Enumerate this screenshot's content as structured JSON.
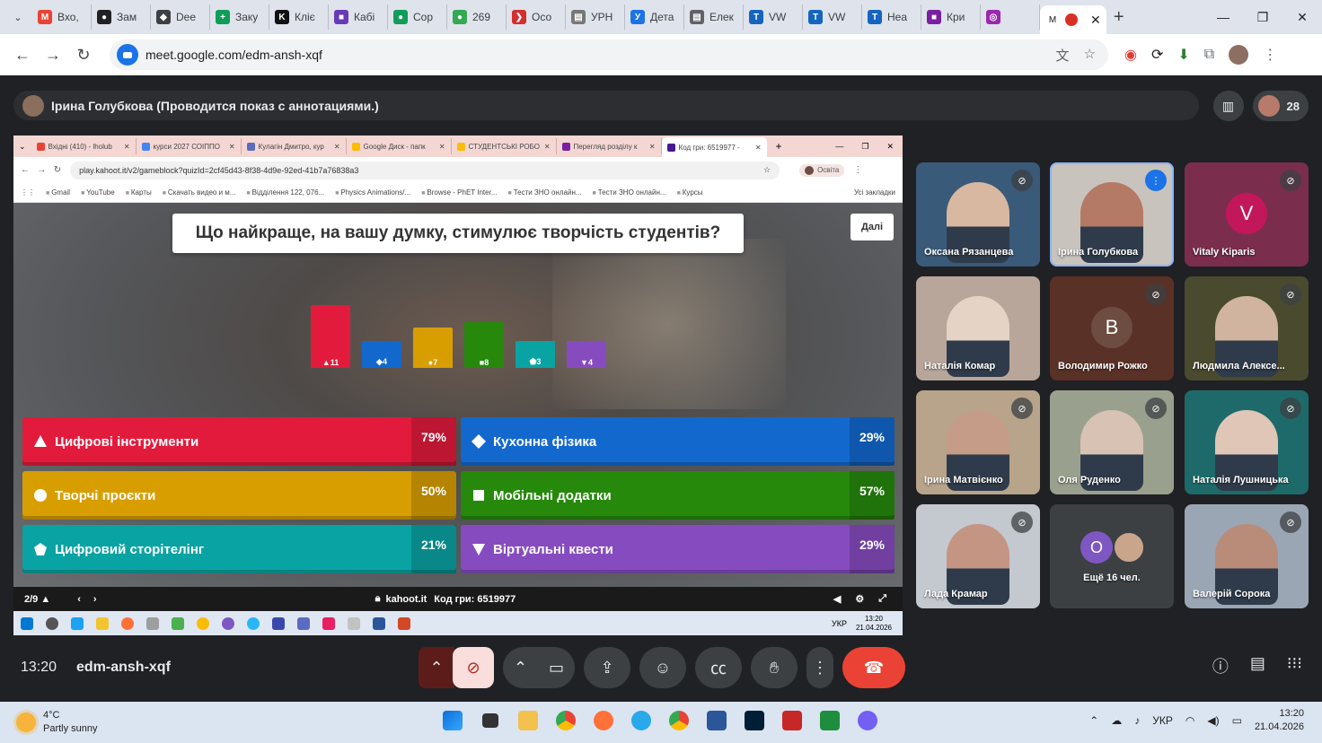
{
  "outer_tabs": [
    {
      "label": "Вхо,",
      "color": "#ea4335",
      "glyph": "M"
    },
    {
      "label": "Зам",
      "color": "#202124",
      "glyph": "●"
    },
    {
      "label": "Dee",
      "color": "#3c4043",
      "glyph": "◆"
    },
    {
      "label": "Заку",
      "color": "#0f9d58",
      "glyph": "+"
    },
    {
      "label": "Кліє",
      "color": "#111",
      "glyph": "K"
    },
    {
      "label": "Кабі",
      "color": "#673ab7",
      "glyph": "■"
    },
    {
      "label": "Сор",
      "color": "#0f9d58",
      "glyph": "●"
    },
    {
      "label": "269",
      "color": "#34a853",
      "glyph": "●"
    },
    {
      "label": "Осо",
      "color": "#d32f2f",
      "glyph": "❯"
    },
    {
      "label": "УРН",
      "color": "#777",
      "glyph": "▤"
    },
    {
      "label": "Дета",
      "color": "#1a73e8",
      "glyph": "У"
    },
    {
      "label": "Елек",
      "color": "#5f6368",
      "glyph": "▤"
    },
    {
      "label": "VW",
      "color": "#1565c0",
      "glyph": "T"
    },
    {
      "label": "VW",
      "color": "#1565c0",
      "glyph": "T"
    },
    {
      "label": "Неа",
      "color": "#1565c0",
      "glyph": "T"
    },
    {
      "label": "Кри",
      "color": "#7b1fa2",
      "glyph": "■"
    },
    {
      "label": "",
      "color": "#9c27b0",
      "glyph": "◎"
    }
  ],
  "active_tab": {
    "label": "М",
    "close": "✕"
  },
  "window_controls": {
    "minimize": "—",
    "maximize": "❐",
    "close": "✕"
  },
  "url": "meet.google.com/edm-ansh-xqf",
  "presenter": "Ірина Голубкова (Проводится показ с аннотациями.)",
  "participant_count": "28",
  "inner_tabs": [
    {
      "label": "Вхідні (410) - lholub",
      "color": "#ea4335"
    },
    {
      "label": "курси 2027 СОІППО",
      "color": "#4285f4"
    },
    {
      "label": "Кулагін Дмитро, кур",
      "color": "#5c6bc0"
    },
    {
      "label": "Google Диск - папк",
      "color": "#fbbc04"
    },
    {
      "label": "СТУДЕНТСЬКІ РОБО",
      "color": "#fbbc04"
    },
    {
      "label": "Перегляд розділу к",
      "color": "#7b1fa2"
    },
    {
      "label": "Код гри: 6519977 -",
      "color": "#46178f"
    }
  ],
  "inner_url": "play.kahoot.it/v2/gameblock?quizId=2cf45d43-8f38-4d9e-92ed-41b7a76838a3",
  "inner_profile": "Освіта",
  "bookmarks": [
    "Gmail",
    "YouTube",
    "Карты",
    "Скачать видео и м...",
    "Відділення 122, 076...",
    "Physics Animations/...",
    "Browse - PhET Inter...",
    "Тести ЗНО онлайн...",
    "Тести ЗНО онлайн...",
    "Курсы"
  ],
  "bookmarks_all": "Усі закладки",
  "question": "Що найкраще, на вашу думку,  стимулює творчість студентів?",
  "next_label": "Далі",
  "vote_bars": [
    {
      "count": "▲11",
      "value": 11,
      "color": "#e21b3c"
    },
    {
      "count": "◆4",
      "value": 4,
      "color": "#1368ce"
    },
    {
      "count": "●7",
      "value": 7,
      "color": "#d89e00"
    },
    {
      "count": "■8",
      "value": 8,
      "color": "#26890c"
    },
    {
      "count": "⬟3",
      "value": 3,
      "color": "#0aa3a3"
    },
    {
      "count": "▼4",
      "value": 4,
      "color": "#864cbf"
    }
  ],
  "answers": [
    {
      "label": "Цифрові інструменти",
      "pct": "79%",
      "color": "#e21b3c",
      "shape": "triangle"
    },
    {
      "label": "Кухонна фізика",
      "pct": "29%",
      "color": "#1368ce",
      "shape": "diamond"
    },
    {
      "label": "Творчі проєкти",
      "pct": "50%",
      "color": "#d89e00",
      "shape": "circle"
    },
    {
      "label": "Мобільні додатки",
      "pct": "57%",
      "color": "#26890c",
      "shape": "square"
    },
    {
      "label": "Цифровий сторітелінг",
      "pct": "21%",
      "color": "#0aa3a3",
      "shape": "pentagon"
    },
    {
      "label": "Віртуальні квести",
      "pct": "29%",
      "color": "#864cbf",
      "shape": "inverted-triangle"
    }
  ],
  "kahoot_footer": {
    "progress": "2/9 ▲",
    "site": "kahoot.it",
    "pin_label": "Код гри: 6519977"
  },
  "inner_taskbar": {
    "lang": "УКР",
    "time": "13:20",
    "date": "21.04.2026"
  },
  "participants": [
    {
      "name": "Оксана Рязанцева",
      "type": "video",
      "bg": "#3a5a7a",
      "tone": "#d8b8a0",
      "mic": "muted"
    },
    {
      "name": "Ірина Голубкова",
      "type": "video",
      "bg": "#c9c3bd",
      "tone": "#b47a66",
      "mic": "speaking"
    },
    {
      "name": "Vitaly Kiparis",
      "type": "avatar",
      "bg": "#7b2d4d",
      "initial": "V",
      "ava": "#c2185b",
      "mic": "muted"
    },
    {
      "name": "Наталія Комар",
      "type": "video",
      "bg": "#b8a69a",
      "tone": "#e5d3c6",
      "mic": "none"
    },
    {
      "name": "Володимир Рожко",
      "type": "avatar",
      "bg": "#5a3126",
      "initial": "B",
      "ava": "#6d4c41",
      "mic": "muted"
    },
    {
      "name": "Людмила Алексе...",
      "type": "video",
      "bg": "#4a4a2e",
      "tone": "#d0b4a0",
      "mic": "muted"
    },
    {
      "name": "Ірина Матвієнко",
      "type": "video",
      "bg": "#b8a48a",
      "tone": "#c49c88",
      "mic": "muted"
    },
    {
      "name": "Оля Руденко",
      "type": "video",
      "bg": "#9aa08e",
      "tone": "#d7c2b4",
      "mic": "muted"
    },
    {
      "name": "Наталія Лушницька",
      "type": "video",
      "bg": "#1e6a6a",
      "tone": "#e0c6b6",
      "mic": "muted"
    },
    {
      "name": "Лада Крамар",
      "type": "video",
      "bg": "#c4c9cf",
      "tone": "#c59584",
      "mic": "muted"
    },
    {
      "name": "Ещё 16 чел.",
      "type": "more",
      "bg": "#3c4043",
      "initial": "О",
      "ava": "#7e57c2",
      "mic": "none"
    },
    {
      "name": "Валерій Сорока",
      "type": "video",
      "bg": "#9aa6b4",
      "tone": "#b88c78",
      "mic": "muted"
    }
  ],
  "meeting_time": "13:20",
  "meeting_code": "edm-ansh-xqf",
  "weather": {
    "temp": "4°C",
    "desc": "Partly sunny"
  },
  "taskbar_lang": "УКР",
  "taskbar_time": "13:20",
  "taskbar_date": "21.04.2026"
}
